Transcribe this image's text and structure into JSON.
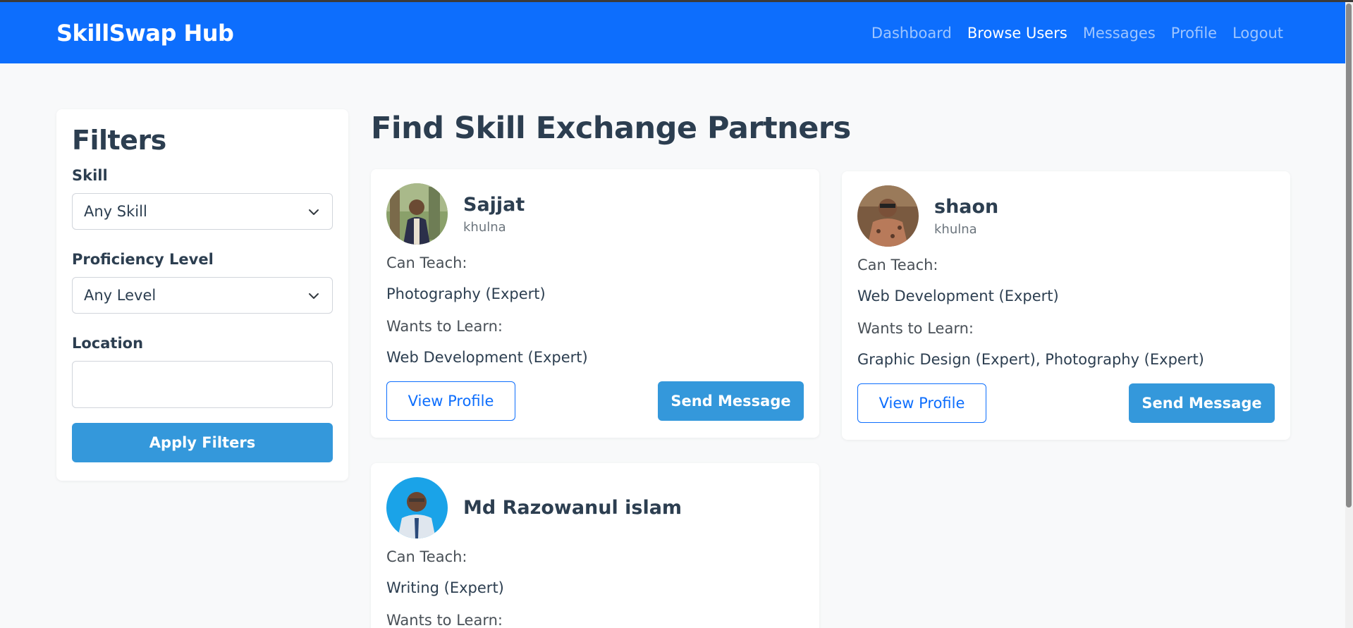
{
  "nav": {
    "brand": "SkillSwap Hub",
    "links": [
      {
        "label": "Dashboard",
        "active": false
      },
      {
        "label": "Browse Users",
        "active": true
      },
      {
        "label": "Messages",
        "active": false
      },
      {
        "label": "Profile",
        "active": false
      },
      {
        "label": "Logout",
        "active": false
      }
    ]
  },
  "filters": {
    "title": "Filters",
    "skill_label": "Skill",
    "skill_value": "Any Skill",
    "level_label": "Proficiency Level",
    "level_value": "Any Level",
    "location_label": "Location",
    "location_value": "",
    "apply_label": "Apply Filters"
  },
  "main": {
    "title": "Find Skill Exchange Partners",
    "can_teach_label": "Can Teach:",
    "wants_label": "Wants to Learn:",
    "view_profile_label": "View Profile",
    "send_message_label": "Send Message",
    "users": [
      {
        "name": "Sajjat",
        "location": "khulna",
        "teach": "Photography (Expert)",
        "learn": "Web Development (Expert)"
      },
      {
        "name": "shaon",
        "location": "khulna",
        "teach": "Web Development (Expert)",
        "learn": "Graphic Design (Expert), Photography (Expert)"
      },
      {
        "name": "Md Razowanul islam",
        "location": "",
        "teach": "Writing (Expert)",
        "learn": ""
      }
    ]
  },
  "colors": {
    "navbar": "#0d6efd",
    "primary_button": "#3498db",
    "background": "#f8f9fa"
  }
}
